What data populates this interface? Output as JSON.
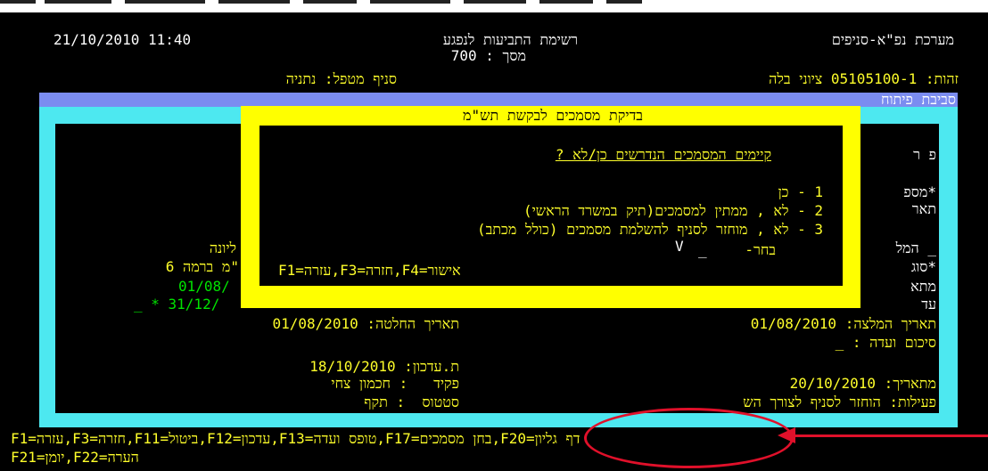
{
  "header": {
    "datetime": "21/10/2010 11:40",
    "screen_title": "רשימת התביעות לנפגע",
    "system_title": "מערכת נפ\"א-סניפים",
    "screen_number": "מסך : 700",
    "id_line": "זהות: 05105100-1 ציוני בלה",
    "branch_line": "סניף מטפל: נתניה",
    "environment": "סביבת פיתוח"
  },
  "background_form": {
    "label_pr": "פ ר",
    "label_mispar": "*מספ",
    "label_toar": "תאר",
    "label_hamal": "_ המל",
    "label_sug": "*סוג",
    "label_mata": "מתא",
    "label_ad": "עד",
    "value_liyona": "ליונה",
    "value_ramah": "\"מ ברמה 6",
    "value_date1": "01/08/",
    "value_date2": "_ * 31/12/",
    "recommendation_date": "תאריך המלצה: 01/08/2010",
    "decision_date": "תאריך החלטה: 01/08/2010",
    "committee_summary": "סיכום ועדה : _",
    "update_date": "ת.עדכון: 18/10/2010",
    "clerk": "פקיד   : חכמון צחי",
    "status": "סטטוס  : תקף",
    "from_date": "מתאריך: 20/10/2010",
    "activity": "פעילות: הוחזר לסניף לצורך הש"
  },
  "dialog": {
    "title": "בדיקת מסמכים לבקשת תש\"מ",
    "question": "קיימים המסמכים הנדרשים כן/לא ?",
    "options": [
      "1 - כן",
      "2 - לא , ממתין למסמכים(תיק במשרד הראשי)",
      "3 - לא , מוחזר לסניף להשלמת מסמכים (כולל מכתב)"
    ],
    "choice_label": "בחר-",
    "choice_value": "_",
    "choice_mark": "V",
    "function_keys": "F1=עזרה,F3=חזרה,F4=אישור"
  },
  "footer": {
    "line1": "F1=עזרה,F3=חזרה,F11=ביטול,F12=עדכון,F13=טופס ועדה,F17=בחן מסמכים,F20=דף גליון",
    "line2": "F21=יומן,F22=הערה"
  },
  "colors": {
    "background": "#000000",
    "text_white": "#ffffff",
    "text_yellow": "#ffff2a",
    "text_green": "#00e400",
    "cyan": "#4de8f0",
    "band_blue": "#7b8cf0",
    "dialog_yellow": "#ffff00",
    "annotation_red": "#e0102a"
  }
}
